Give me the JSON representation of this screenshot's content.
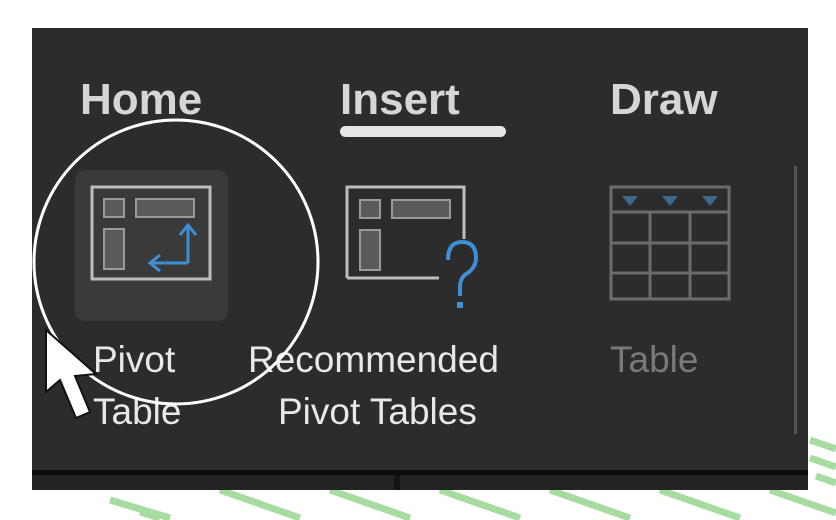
{
  "tabs": [
    {
      "label": "Home"
    },
    {
      "label": "Insert",
      "active": true
    },
    {
      "label": "Draw"
    }
  ],
  "ribbon": {
    "pivot_table": {
      "line1": "Pivot",
      "line2": "Table"
    },
    "recommended": {
      "line1": "Recommended",
      "line2": "Pivot Tables"
    },
    "table": {
      "label": "Table"
    }
  },
  "colors": {
    "panel": "#2c2c2c",
    "accent_blue": "#3d8fd6",
    "stripes": "#9fd89a",
    "disabled": "#6e6e6e"
  }
}
